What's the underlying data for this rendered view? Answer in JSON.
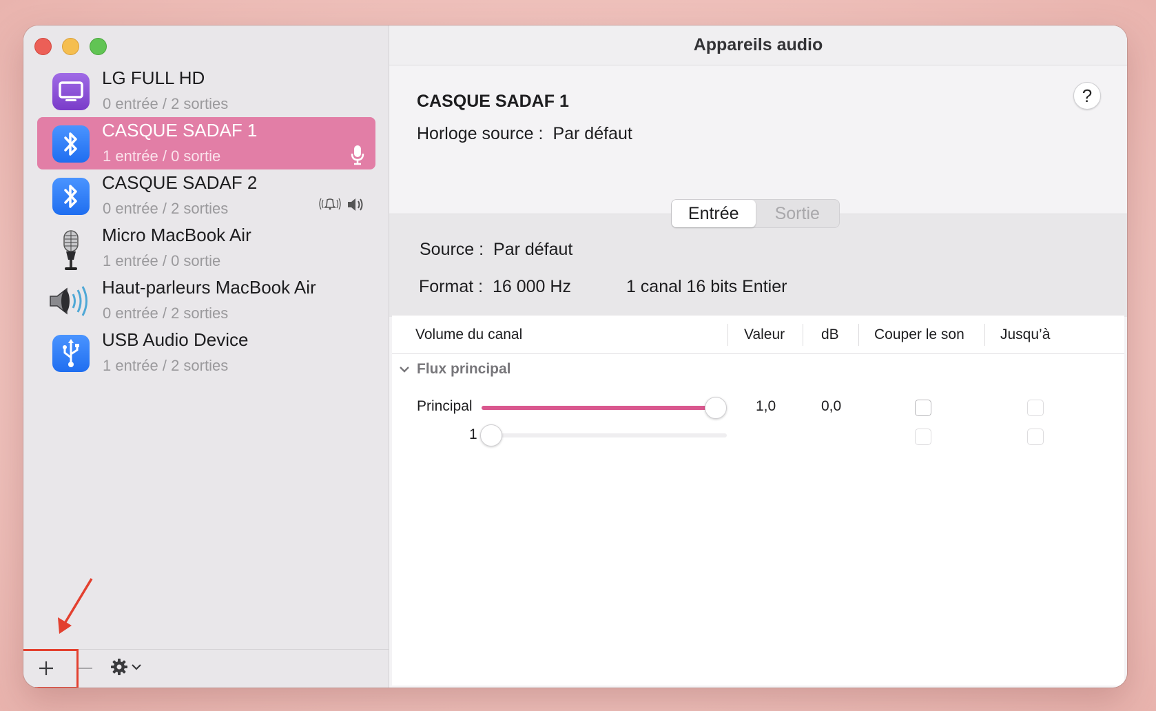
{
  "window_title": "Appareils audio",
  "sidebar": {
    "devices": [
      {
        "name": "LG FULL HD",
        "io": "0 entrée / 2 sorties",
        "icon": "display-icon",
        "color": "#8a4bd4"
      },
      {
        "name": "CASQUE SADAF 1",
        "io": "1 entrée / 0 sortie",
        "icon": "bluetooth-icon",
        "color": "#2f7df6",
        "selected": true,
        "badge": "microphone-icon"
      },
      {
        "name": "CASQUE SADAF 2",
        "io": "0 entrée / 2 sorties",
        "icon": "bluetooth-icon",
        "color": "#2f7df6",
        "badge": "alert-speaker-icon"
      },
      {
        "name": "Micro MacBook Air",
        "io": "1 entrée / 0 sortie",
        "icon": "microphone-icon"
      },
      {
        "name": "Haut-parleurs MacBook Air",
        "io": "0 entrée / 2 sorties",
        "icon": "speaker-icon"
      },
      {
        "name": "USB Audio Device",
        "io": "1 entrée / 2 sorties",
        "icon": "usb-icon",
        "color": "#2f7df6"
      }
    ],
    "toolbar": {
      "add": "+",
      "remove": "—",
      "gear": "gear-icon",
      "menu": "chevron-down-icon"
    }
  },
  "detail": {
    "device_title": "CASQUE SADAF 1",
    "clock_label": "Horloge source :",
    "clock_value": "Par défaut",
    "help": "?",
    "tabs": [
      {
        "label": "Entrée",
        "active": true
      },
      {
        "label": "Sortie",
        "active": false
      }
    ],
    "source_label": "Source :",
    "source_value": "Par défaut",
    "format_label": "Format :",
    "format_rate": "16 000 Hz",
    "format_detail": "1 canal 16 bits Entier"
  },
  "table": {
    "columns": [
      "Volume du canal",
      "Valeur",
      "dB",
      "Couper le son",
      "Jusqu’à"
    ],
    "group": "Flux principal",
    "rows": [
      {
        "label": "Principal",
        "volume": 1.0,
        "value": "1,0",
        "db": "0,0",
        "mute": false,
        "thru": false,
        "enabled": true
      },
      {
        "label": "1",
        "volume": 0.0,
        "value": "",
        "db": "",
        "mute": false,
        "thru": false,
        "enabled": false
      }
    ]
  },
  "accent_color": "#d9578e",
  "annotation_color": "#e3402f"
}
